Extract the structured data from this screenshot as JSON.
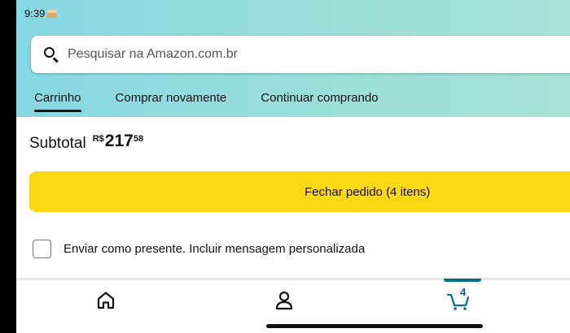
{
  "status_bar": {
    "time": "9:39"
  },
  "search": {
    "placeholder": "Pesquisar na Amazon.com.br"
  },
  "tabs": [
    {
      "label": "Carrinho",
      "active": true
    },
    {
      "label": "Comprar novamente",
      "active": false
    },
    {
      "label": "Continuar comprando",
      "active": false
    }
  ],
  "subtotal": {
    "label": "Subtotal",
    "currency": "R$",
    "integer": "217",
    "decimal": "58"
  },
  "checkout": {
    "label": "Fechar pedido (4 itens)",
    "color": "#ffd814"
  },
  "gift": {
    "label": "Enviar como presente. Incluir mensagem personalizada",
    "checked": false
  },
  "bottom_nav": {
    "items": [
      {
        "icon": "home-icon"
      },
      {
        "icon": "user-icon"
      },
      {
        "icon": "cart-icon",
        "count": "4",
        "active": true
      }
    ]
  },
  "colors": {
    "accent": "#007185",
    "header_gradient_start": "#86d8e4",
    "header_gradient_end": "#a6e3d4"
  }
}
